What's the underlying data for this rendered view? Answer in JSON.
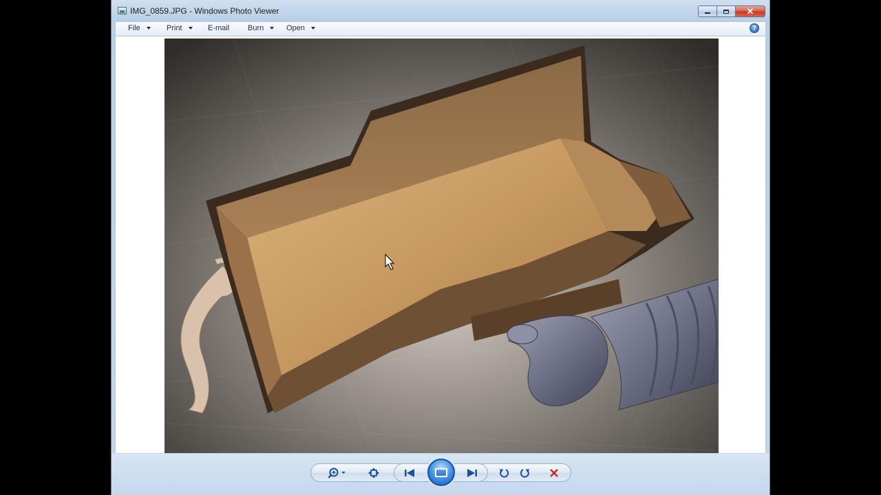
{
  "window": {
    "title": "IMG_0859.JPG - Windows Photo Viewer",
    "controls": {
      "minimize": "minimize",
      "maximize": "maximize",
      "close": "close"
    }
  },
  "menu": {
    "items": [
      {
        "label": "File",
        "has_dropdown": true
      },
      {
        "label": "Print",
        "has_dropdown": true
      },
      {
        "label": "E-mail",
        "has_dropdown": false
      },
      {
        "label": "Burn",
        "has_dropdown": true
      },
      {
        "label": "Open",
        "has_dropdown": true
      }
    ],
    "help_glyph": "?"
  },
  "photo": {
    "filename": "IMG_0859.JPG",
    "subject": "photo"
  },
  "toolbar": {
    "buttons": [
      {
        "name": "zoom",
        "icon": "magnifier-icon"
      },
      {
        "name": "actual-size",
        "icon": "fit-window-icon"
      },
      {
        "name": "previous",
        "icon": "previous-icon"
      },
      {
        "name": "slideshow",
        "icon": "slideshow-icon"
      },
      {
        "name": "next",
        "icon": "next-icon"
      },
      {
        "name": "rotate-counterclockwise",
        "icon": "rotate-left-icon"
      },
      {
        "name": "rotate-clockwise",
        "icon": "rotate-right-icon"
      },
      {
        "name": "delete",
        "icon": "delete-icon"
      }
    ]
  },
  "colors": {
    "toolbar_glyph": "#1f4f9c",
    "delete": "#c8281c",
    "frame": "#c3d6ec"
  }
}
